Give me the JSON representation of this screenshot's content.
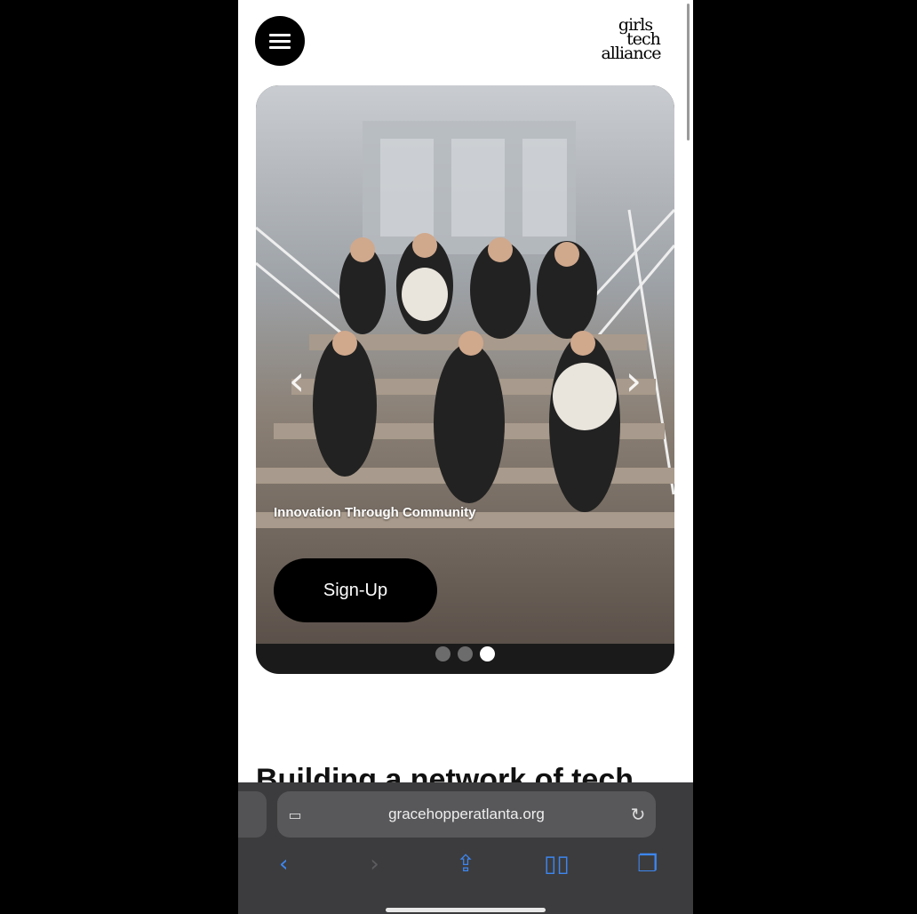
{
  "header": {
    "menu_icon": "hamburger-icon",
    "logo_lines": [
      "girls",
      "tech",
      "alliance"
    ]
  },
  "carousel": {
    "tagline": "Innovation Through Community",
    "signup_label": "Sign-Up",
    "prev_icon": "chevron-left-icon",
    "next_icon": "chevron-right-icon",
    "prev_glyph": "‹",
    "next_glyph": "›",
    "slides_total": 3,
    "active_slide": 3
  },
  "section": {
    "heading_partial": "Building a network of tech"
  },
  "browser": {
    "url": "gracehopperatlanta.org",
    "reader_glyph": "▭",
    "reload_glyph": "↻",
    "toolbar": [
      {
        "icon": "back-icon",
        "glyph": "‹",
        "enabled": true
      },
      {
        "icon": "forward-icon",
        "glyph": "›",
        "enabled": false
      },
      {
        "icon": "share-icon",
        "glyph": "⇪",
        "enabled": true
      },
      {
        "icon": "bookmarks-icon",
        "glyph": "▯▯",
        "enabled": true
      },
      {
        "icon": "tabs-icon",
        "glyph": "❐",
        "enabled": true
      }
    ]
  },
  "colors": {
    "accent": "#3d86f0",
    "button": "#000000",
    "browser_chrome": "#3c3c3e"
  }
}
